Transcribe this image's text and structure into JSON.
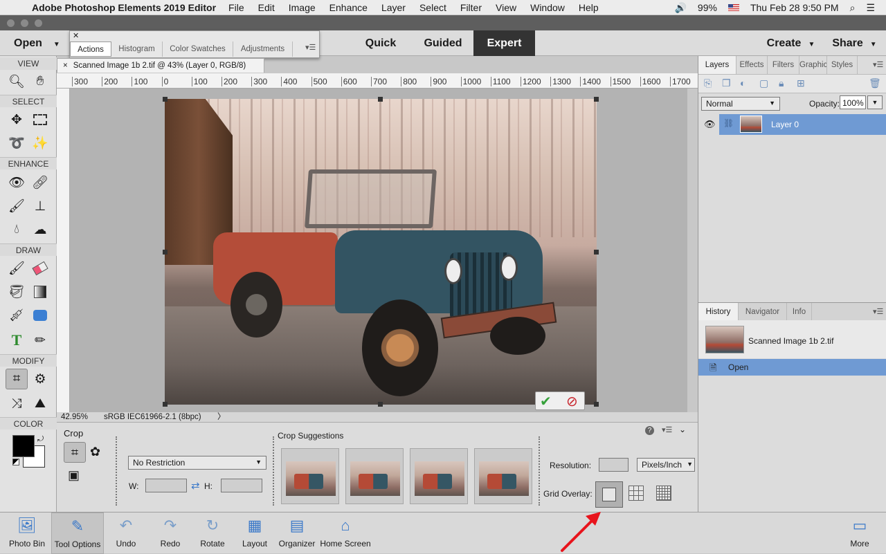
{
  "menubar": {
    "app_name": "Adobe Photoshop Elements 2019 Editor",
    "items": [
      "File",
      "Edit",
      "Image",
      "Enhance",
      "Layer",
      "Select",
      "Filter",
      "View",
      "Window",
      "Help"
    ],
    "battery": "99%",
    "datetime": "Thu Feb 28  9:50 PM"
  },
  "modebar": {
    "open_label": "Open",
    "modes": [
      "Quick",
      "Guided",
      "Expert"
    ],
    "active_mode": "Expert",
    "create_label": "Create",
    "share_label": "Share"
  },
  "float_panel": {
    "tabs": [
      "Actions",
      "Histogram",
      "Color Swatches",
      "Adjustments"
    ]
  },
  "toolbox": {
    "sections": [
      "VIEW",
      "SELECT",
      "ENHANCE",
      "DRAW",
      "MODIFY",
      "COLOR"
    ]
  },
  "document": {
    "tab_title": "Scanned Image 1b 2.tif @ 43% (Layer 0, RGB/8)",
    "ruler_labels": [
      "300",
      "200",
      "100",
      "0",
      "100",
      "200",
      "300",
      "400",
      "500",
      "600",
      "700",
      "800",
      "900",
      "1000",
      "1100",
      "1200",
      "1300",
      "1400",
      "1500",
      "1600",
      "1700"
    ],
    "zoom": "42.95%",
    "color_profile": "sRGB IEC61966-2.1 (8bpc)"
  },
  "tool_options": {
    "title": "Crop",
    "restriction": "No Restriction",
    "w_label": "W:",
    "h_label": "H:",
    "suggestions_label": "Crop Suggestions",
    "resolution_label": "Resolution:",
    "resolution_unit": "Pixels/Inch",
    "grid_overlay_label": "Grid Overlay:"
  },
  "layers_panel": {
    "tabs": [
      "Layers",
      "Effects",
      "Filters",
      "Graphics",
      "Styles"
    ],
    "blend_mode": "Normal",
    "opacity_label": "Opacity:",
    "opacity_value": "100%",
    "layer_name": "Layer 0"
  },
  "history_panel": {
    "tabs": [
      "History",
      "Navigator",
      "Info"
    ],
    "snapshot_label": "Scanned Image 1b 2.tif",
    "step_label": "Open"
  },
  "taskbar": {
    "items": [
      "Photo Bin",
      "Tool Options",
      "Undo",
      "Redo",
      "Rotate",
      "Layout",
      "Organizer",
      "Home Screen"
    ],
    "more_label": "More"
  },
  "colors": {
    "accent": "#5b8fd0",
    "selection_bg": "#6f9ad3",
    "title_bar": "#5e5e5e",
    "annotation_arrow": "#e8141c"
  }
}
